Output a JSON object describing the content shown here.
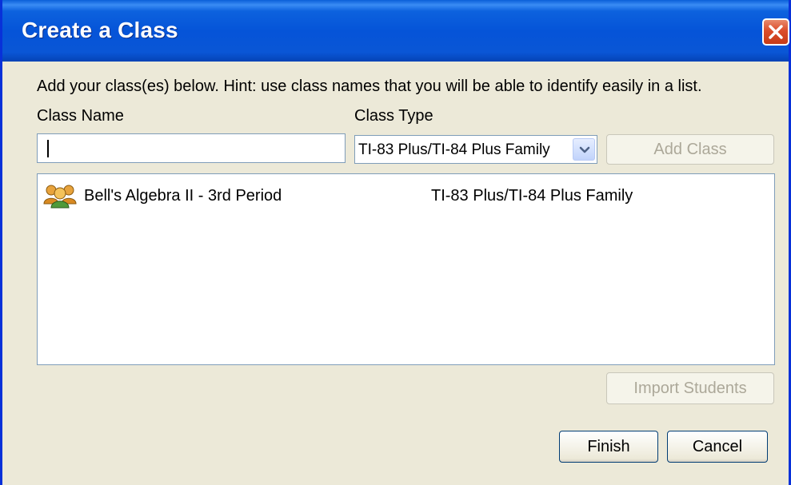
{
  "window": {
    "title": "Create a Class",
    "close_icon": "close-icon"
  },
  "form": {
    "hint": "Add your class(es) below.  Hint: use class names that you will be able to identify easily in a list.",
    "class_name_label": "Class Name",
    "class_name_value": "",
    "class_type_label": "Class Type",
    "class_type_selected": "TI-83 Plus/TI-84 Plus Family",
    "add_class_label": "Add Class"
  },
  "classes": [
    {
      "icon": "group-icon",
      "name": "Bell's Algebra II - 3rd Period",
      "type": "TI-83 Plus/TI-84 Plus Family"
    }
  ],
  "buttons": {
    "import_students": "Import Students",
    "finish": "Finish",
    "cancel": "Cancel"
  },
  "colors": {
    "title_bar": "#0554d8",
    "window_bg": "#ece9d8",
    "close_button": "#db4c2a"
  }
}
